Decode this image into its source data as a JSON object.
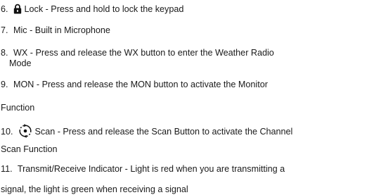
{
  "items": [
    {
      "number": "6.",
      "icon": "lock-icon",
      "lines": [
        "Lock - Press and hold to lock the keypad"
      ]
    },
    {
      "number": "7.",
      "lines": [
        "Mic - Built in Microphone"
      ]
    },
    {
      "number": "8.",
      "lines": [
        "WX - Press and release the WX button to enter the Weather Radio",
        "Mode"
      ]
    },
    {
      "number": "9.",
      "lines": [
        "MON - Press and release the MON button to activate the Monitor",
        "Function"
      ]
    },
    {
      "number": "10.",
      "icon": "scan-icon",
      "lines": [
        "Scan - Press and release the Scan Button to activate the Channel",
        "Scan Function"
      ]
    },
    {
      "number": "11.",
      "lines": [
        "Transmit/Receive Indicator - Light is red when you are transmitting a",
        "signal, the light is green when receiving a signal"
      ]
    }
  ]
}
